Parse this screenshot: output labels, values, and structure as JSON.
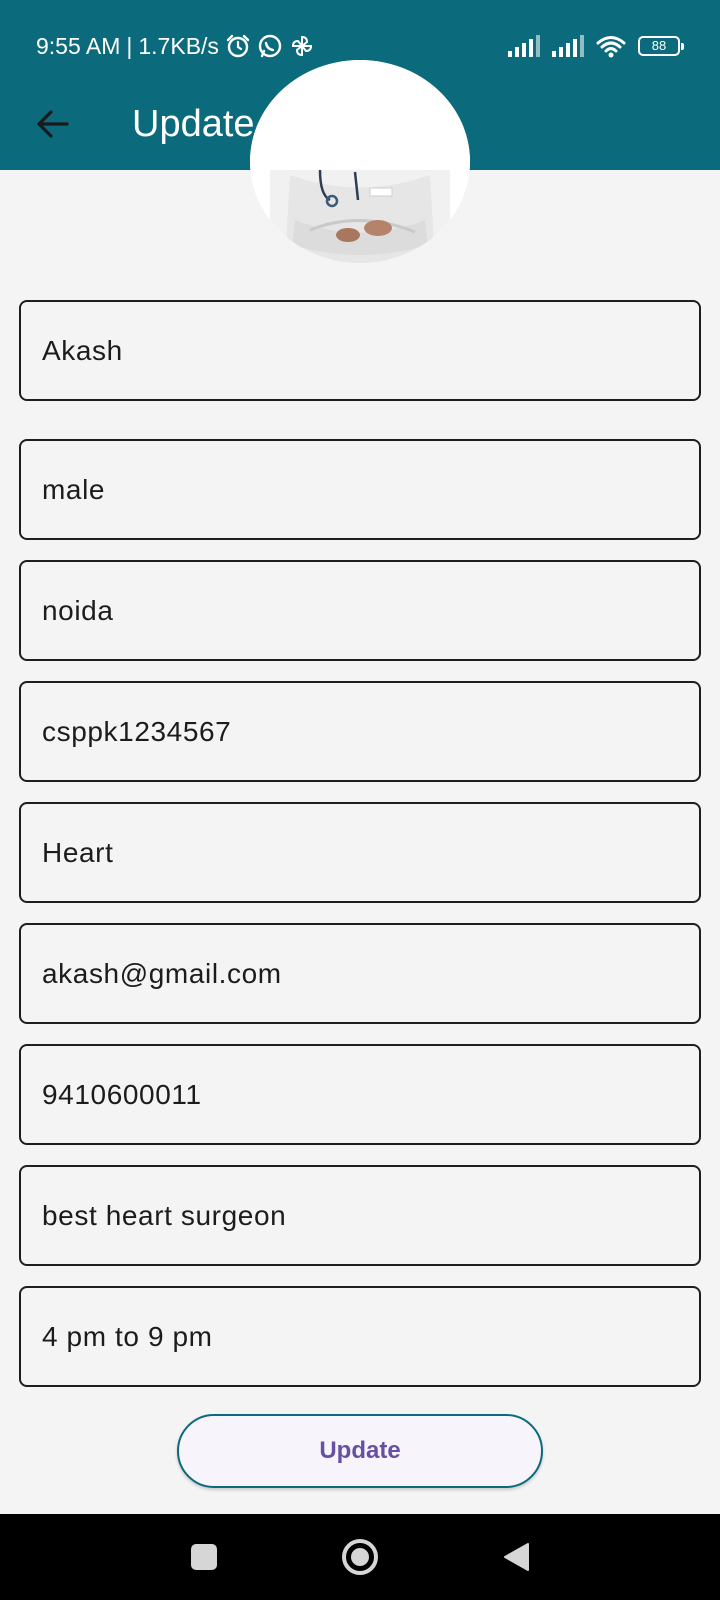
{
  "status_bar": {
    "time": "9:55 AM",
    "network_speed": "1.7KB/s",
    "separator": "|",
    "battery_level": "88",
    "icons": [
      "alarm-icon",
      "whatsapp-icon",
      "pinwheel-icon",
      "signal-icon",
      "signal-icon",
      "wifi-icon",
      "battery-icon"
    ]
  },
  "app_bar": {
    "title": "Update Profile",
    "back_icon": "arrow-left-icon"
  },
  "form": {
    "fields": [
      {
        "name": "name",
        "value": "Akash"
      },
      {
        "name": "gender",
        "value": "male"
      },
      {
        "name": "city",
        "value": "noida"
      },
      {
        "name": "registration-id",
        "value": "csppk1234567"
      },
      {
        "name": "specialization",
        "value": "Heart"
      },
      {
        "name": "email",
        "value": "akash@gmail.com"
      },
      {
        "name": "phone",
        "value": "9410600011"
      },
      {
        "name": "description",
        "value": "best heart surgeon"
      },
      {
        "name": "timing",
        "value": "4 pm to 9 pm"
      }
    ],
    "submit_label": "Update"
  },
  "nav_bar": {
    "icons": [
      "recents-square-icon",
      "home-circle-icon",
      "back-triangle-icon"
    ]
  },
  "colors": {
    "app_bar": "#0b6b7c",
    "background": "#f4f4f4",
    "button_text": "#6750a4",
    "button_border": "#0b6b7c"
  }
}
